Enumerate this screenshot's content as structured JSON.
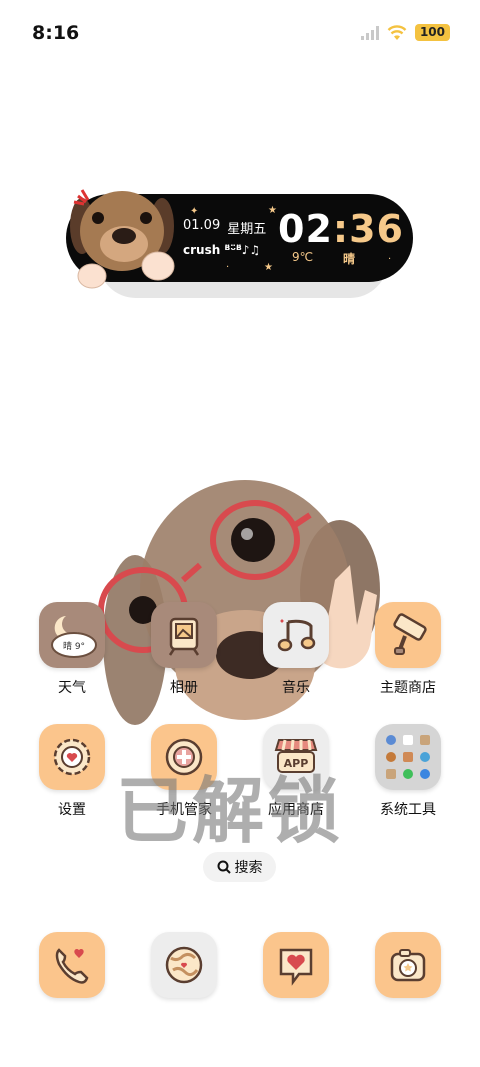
{
  "status_bar": {
    "time": "8:16",
    "battery": "100"
  },
  "widget": {
    "date": "01.09",
    "weekday": "星期五",
    "song": "crush ᴮ̈ᵕ̈ᴮ̈♪♫",
    "clock_hour": "02",
    "clock_sep": ":",
    "clock_min": "36",
    "temperature": "9℃",
    "weather": "晴"
  },
  "apps": [
    {
      "label": "天气",
      "icon": "weather-icon",
      "icon_text": "晴 9°"
    },
    {
      "label": "相册",
      "icon": "gallery-icon"
    },
    {
      "label": "音乐",
      "icon": "music-icon"
    },
    {
      "label": "主题商店",
      "icon": "theme-store-icon"
    },
    {
      "label": "设置",
      "icon": "settings-icon"
    },
    {
      "label": "手机管家",
      "icon": "security-icon"
    },
    {
      "label": "应用商店",
      "icon": "app-store-icon",
      "icon_text": "APP"
    },
    {
      "label": "系统工具",
      "icon": "system-tools-folder-icon"
    }
  ],
  "lock_overlay": "已解锁",
  "search": {
    "label": "搜索"
  },
  "dock": [
    {
      "icon": "phone-icon"
    },
    {
      "icon": "browser-icon"
    },
    {
      "icon": "messages-icon"
    },
    {
      "icon": "camera-icon"
    }
  ],
  "colors": {
    "widget_bg": "#0a0a0a",
    "widget_accent": "#f6c98a",
    "icon_peach": "#fbc58c",
    "icon_taupe": "#a88a7a",
    "battery": "#f4c240"
  }
}
